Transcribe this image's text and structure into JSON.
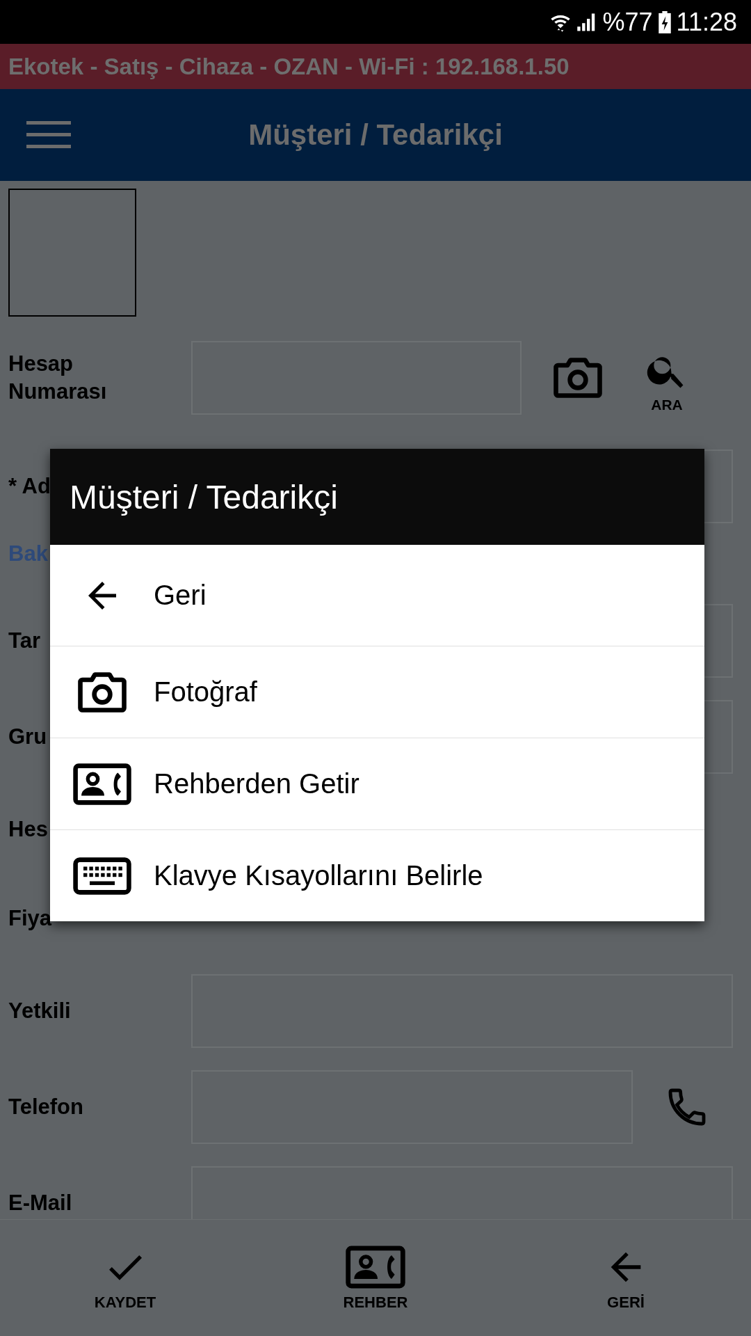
{
  "status_bar": {
    "battery": "%77",
    "time": "11:28"
  },
  "banner": "Ekotek - Satış - Cihaza - OZAN - Wi-Fi : 192.168.1.50",
  "app_bar": {
    "title": "Müşteri / Tedarikçi"
  },
  "form": {
    "account_label": "Hesap Numarası",
    "search_label": "ARA",
    "rows": [
      {
        "label": "* Ad",
        "kind": "field"
      },
      {
        "label": "Bak",
        "kind": "section"
      },
      {
        "label": "Tar",
        "kind": "field"
      },
      {
        "label": "Gru",
        "kind": "field"
      },
      {
        "label": "Hes",
        "kind": "text"
      },
      {
        "label": "Fiya",
        "kind": "text"
      },
      {
        "label": "Yetkili",
        "kind": "field"
      },
      {
        "label": "Telefon",
        "kind": "phone"
      },
      {
        "label": "E-Mail",
        "kind": "field"
      }
    ]
  },
  "dialog": {
    "title": "Müşteri / Tedarikçi",
    "items": [
      {
        "label": "Geri",
        "kind": "back"
      },
      {
        "label": "Fotoğraf",
        "kind": "camera"
      },
      {
        "label": "Rehberden Getir",
        "kind": "contact"
      },
      {
        "label": "Klavye Kısayollarını Belirle",
        "kind": "keyboard"
      }
    ]
  },
  "bottom_bar": [
    {
      "label": "KAYDET",
      "kind": "check"
    },
    {
      "label": "REHBER",
      "kind": "contact"
    },
    {
      "label": "GERİ",
      "kind": "back"
    }
  ]
}
